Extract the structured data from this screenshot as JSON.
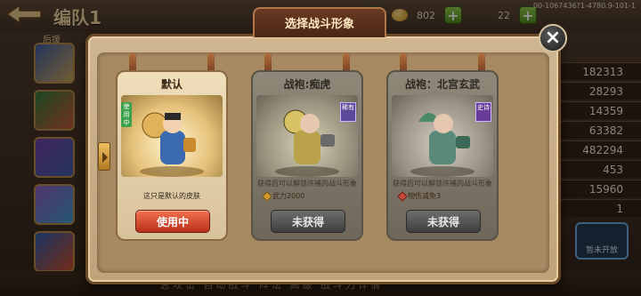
{
  "header": {
    "team_title": "编队1",
    "subtitle": "后援",
    "resources": [
      {
        "icon": "gold-ingot-icon",
        "value": "802"
      },
      {
        "icon": "stamina-icon",
        "value": "22"
      }
    ],
    "build_id": "00-1067436?1-4780.9-101-1"
  },
  "background_stats": [
    "182313",
    "28293",
    "14359",
    "63382",
    "482294",
    "453",
    "15960",
    "1"
  ],
  "not_open_label": "暂未开放",
  "bottom_text": "总攻击   自动战斗   阵法   高级   战斗力详情",
  "modal": {
    "title": "选择战斗形象",
    "close_icon": "close-icon",
    "cards": [
      {
        "title": "默认",
        "tag": "使用中",
        "description": "这只是默认的皮肤",
        "bonus": "",
        "button": "使用中",
        "state": "using"
      },
      {
        "title": "战袍:痴虎",
        "rarity": "稀有",
        "description": "获得后可以解锁许褚的战斗形象",
        "bonus": "武力2000",
        "button": "未获得",
        "state": "unobtained"
      },
      {
        "title": "战袍：北宫玄武",
        "rarity": "史诗",
        "description": "获得后可以解锁许褚的战斗形象",
        "bonus": "物伤减免3",
        "button": "未获得",
        "state": "unobtained"
      }
    ]
  },
  "colors": {
    "accent": "#c9381f",
    "card_bg": "#e6d2ac",
    "locked_bg": "#7f7769"
  }
}
